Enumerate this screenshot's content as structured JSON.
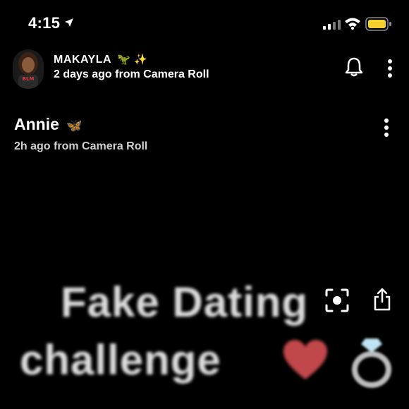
{
  "status_bar": {
    "time": "4:15"
  },
  "header": {
    "username": "MAKAYLA",
    "username_emojis": "🦖 ✨",
    "subtitle": "2 days ago from Camera Roll",
    "avatar_badge": "BLM"
  },
  "story": {
    "owner": "Annie",
    "owner_emoji": "🦋",
    "meta": "2h ago from Camera Roll"
  },
  "caption": {
    "line1": "Fake Dating",
    "line2": "challenge"
  },
  "icons": {
    "location": "location-arrow-icon",
    "signal": "cell-signal-icon",
    "wifi": "wifi-icon",
    "battery": "battery-icon",
    "bell": "bell-icon",
    "more": "more-vertical-icon",
    "scan": "scan-icon",
    "share": "share-icon",
    "heart": "heart-emoji",
    "ring": "ring-emoji"
  },
  "colors": {
    "background": "#000000",
    "battery_fill": "#f5d130",
    "text": "#ffffff",
    "heart": "#c0474a"
  }
}
